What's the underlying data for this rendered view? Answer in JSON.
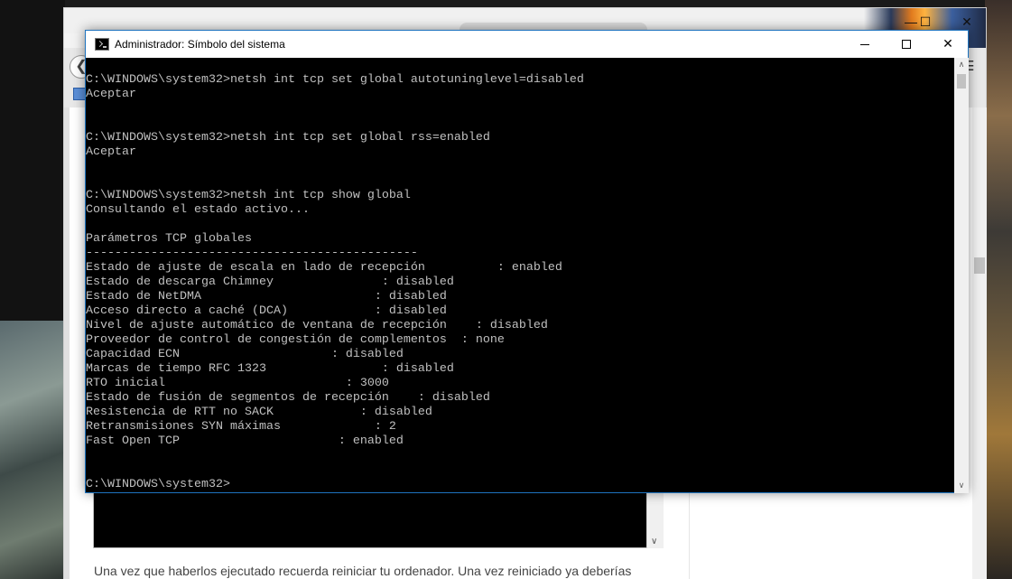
{
  "cmd": {
    "title": "Administrador: Símbolo del sistema",
    "minimize": "—",
    "maximize": "☐",
    "close": "✕",
    "lines": [
      "C:\\WINDOWS\\system32>netsh int tcp set global autotuninglevel=disabled",
      "Aceptar",
      "",
      "",
      "C:\\WINDOWS\\system32>netsh int tcp set global rss=enabled",
      "Aceptar",
      "",
      "",
      "C:\\WINDOWS\\system32>netsh int tcp show global",
      "Consultando el estado activo...",
      "",
      "Parámetros TCP globales",
      "----------------------------------------------",
      "Estado de ajuste de escala en lado de recepción          : enabled",
      "Estado de descarga Chimney               : disabled",
      "Estado de NetDMA                        : disabled",
      "Acceso directo a caché (DCA)            : disabled",
      "Nivel de ajuste automático de ventana de recepción    : disabled",
      "Proveedor de control de congestión de complementos  : none",
      "Capacidad ECN                     : disabled",
      "Marcas de tiempo RFC 1323                : disabled",
      "RTO inicial                         : 3000",
      "Estado de fusión de segmentos de recepción    : disabled",
      "Resistencia de RTT no SACK            : disabled",
      "Retransmisiones SYN máximas             : 2",
      "Fast Open TCP                      : enabled",
      "",
      "",
      "C:\\WINDOWS\\system32>"
    ],
    "scroll_up": "∧",
    "scroll_down": "∨"
  },
  "browser": {
    "back_icon": "back-arrow-icon",
    "back_glyph": "❮",
    "menu_glyph": "☰",
    "window_controls": {
      "minimize": "—",
      "maximize": "☐",
      "close": "✕"
    },
    "code_scroll_down": "∨",
    "paragraph": "Una vez que haberlos ejecutado recuerda reiniciar tu ordenador. Una vez reiniciado ya deberías"
  },
  "colors": {
    "console_bg": "#000000",
    "console_text": "#c0c0c0",
    "window_border": "#1e73be"
  }
}
